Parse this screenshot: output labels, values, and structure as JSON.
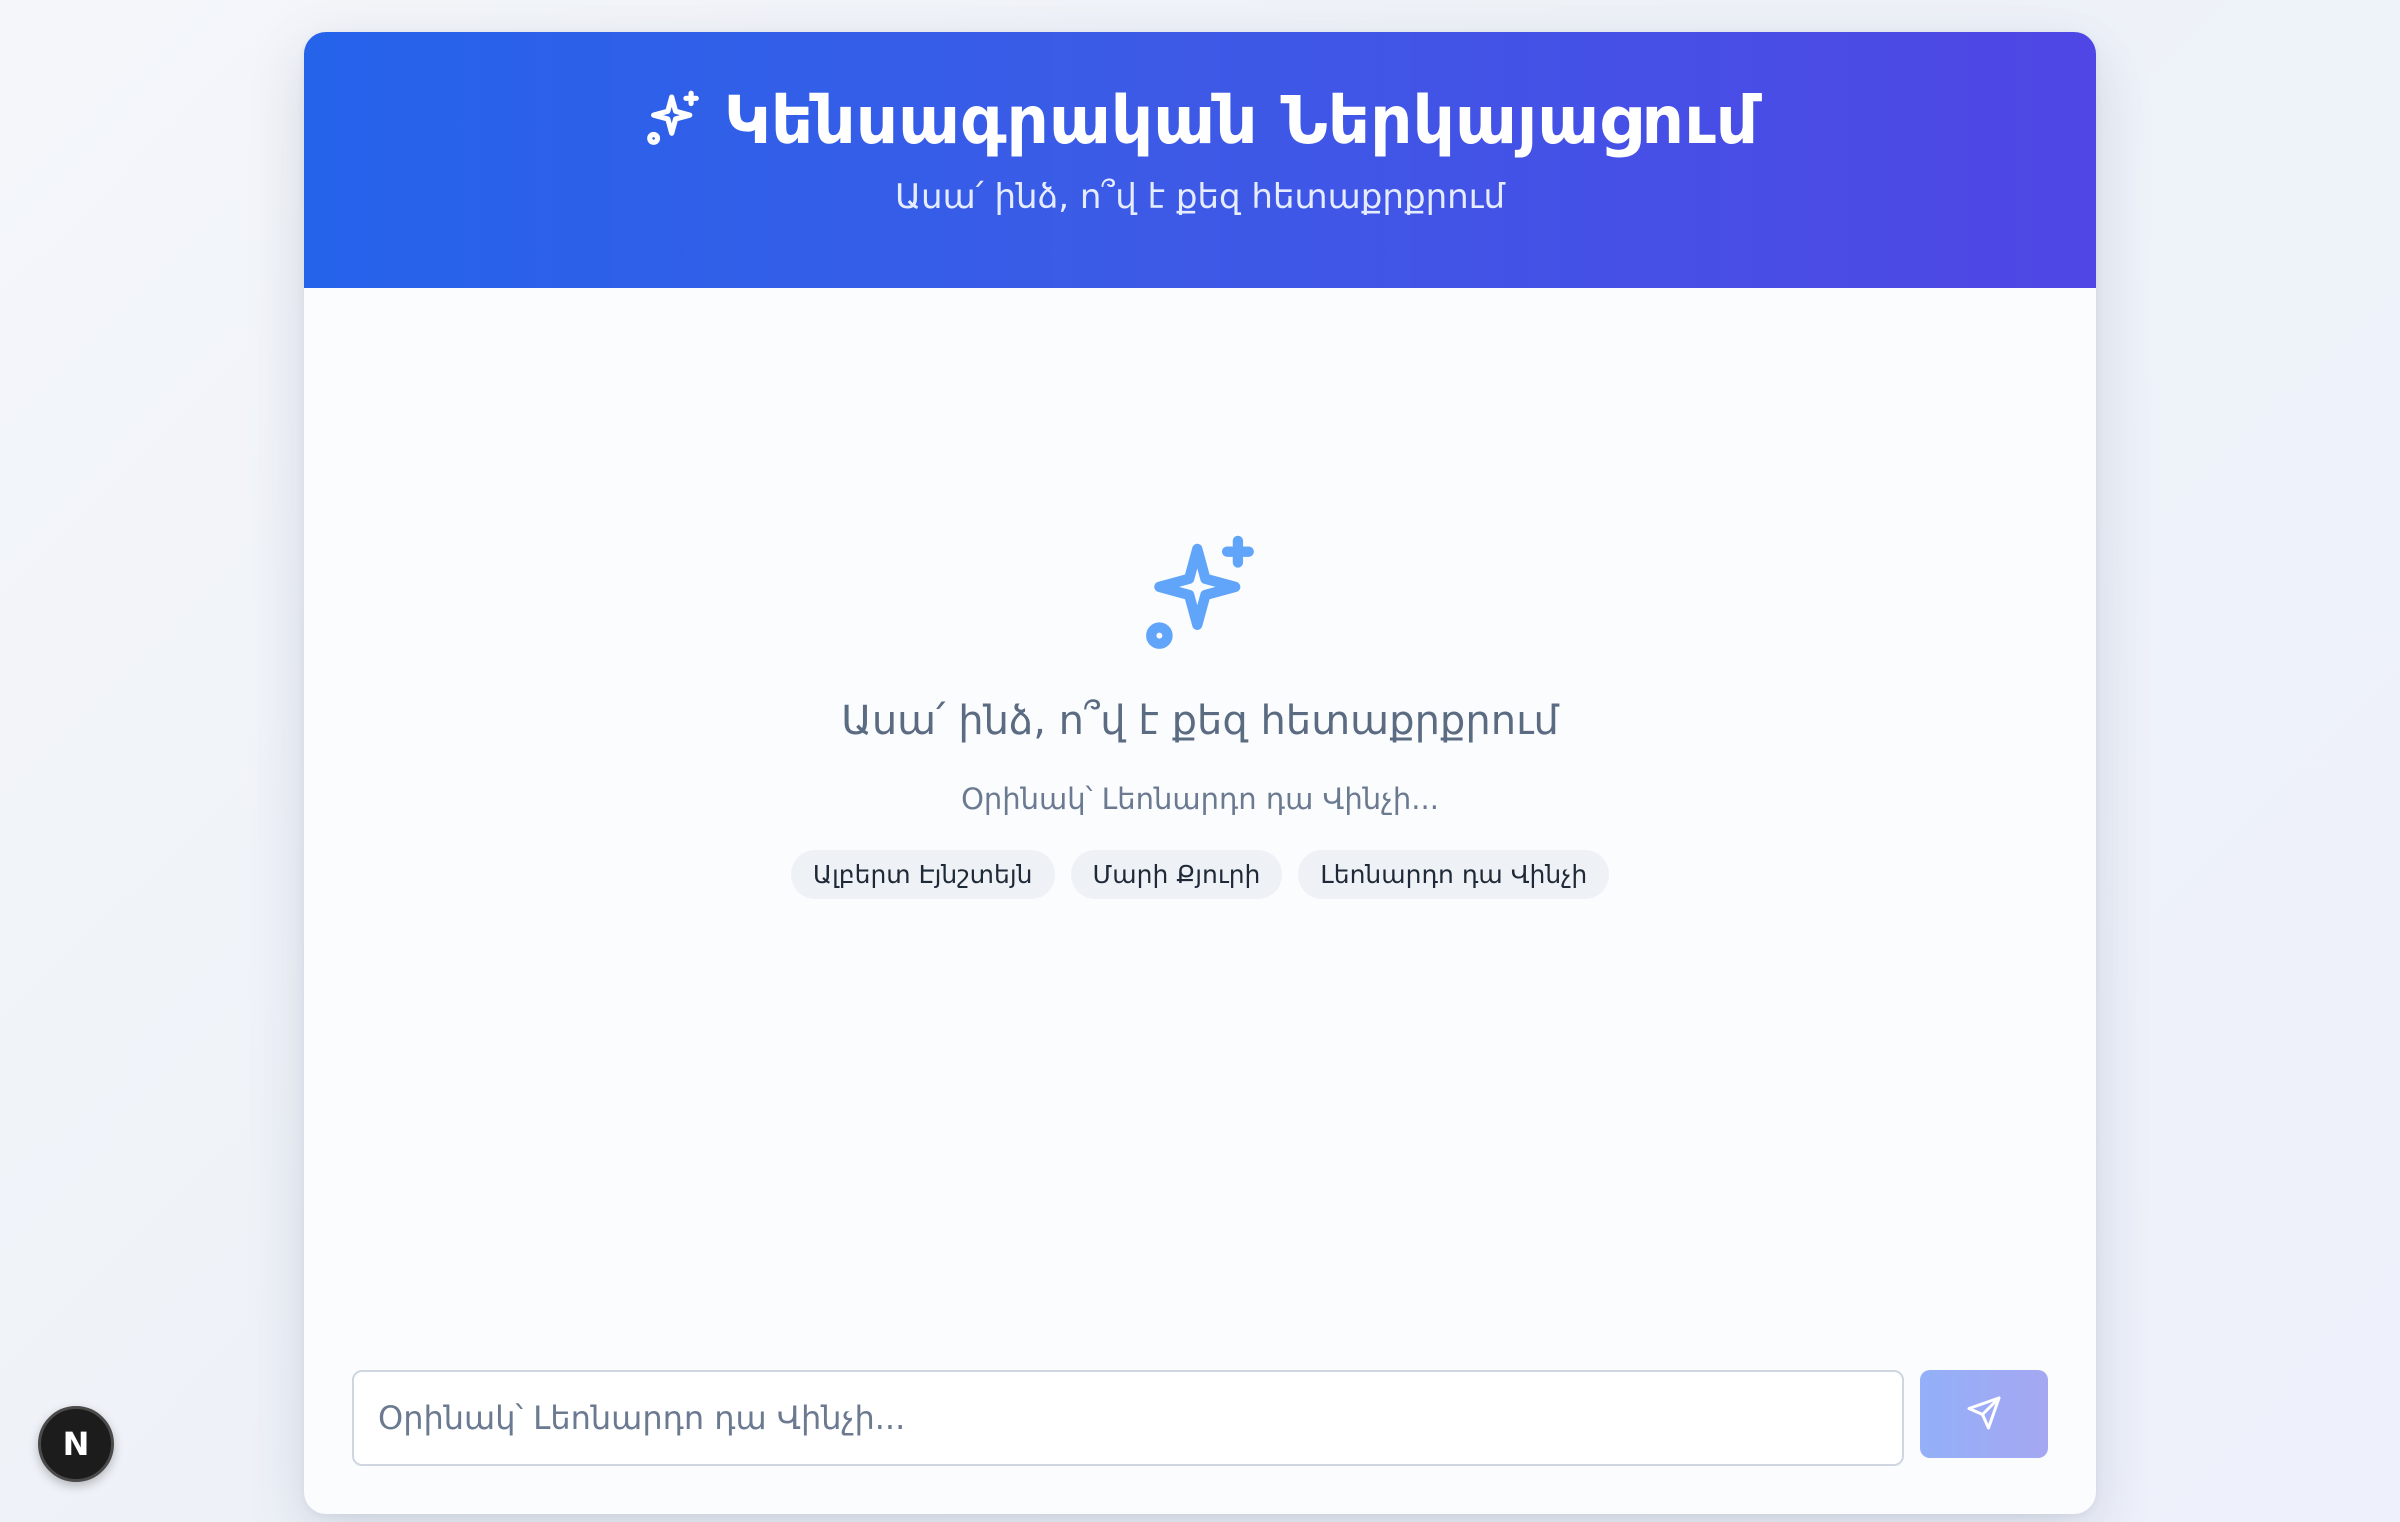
{
  "header": {
    "title": "Կենսագրական Ներկայացում",
    "subtitle": "Ասա՛ ինձ, ո՞վ է քեզ հետաքրքրում",
    "icon": "sparkles-icon"
  },
  "empty_state": {
    "icon": "sparkles-icon",
    "prompt": "Ասա՛ ինձ, ո՞վ է քեզ հետաքրքրում",
    "example": "Օրինակ՝ Լեոնարդո դա Վինչի...",
    "suggestions": [
      "Ալբերտ Էյնշտեյն",
      "Մարի Քյուրի",
      "Լեոնարդո դա Վինչի"
    ]
  },
  "input": {
    "value": "",
    "placeholder": "Օրինակ՝ Լեոնարդո դա Վինչի...",
    "send_icon": "send-icon"
  },
  "badge": {
    "label": "N"
  },
  "colors": {
    "header_gradient_start": "#2563eb",
    "header_gradient_end": "#4f46e5",
    "accent_icon": "#60a5fa",
    "send_button": "#9aaaf5"
  }
}
